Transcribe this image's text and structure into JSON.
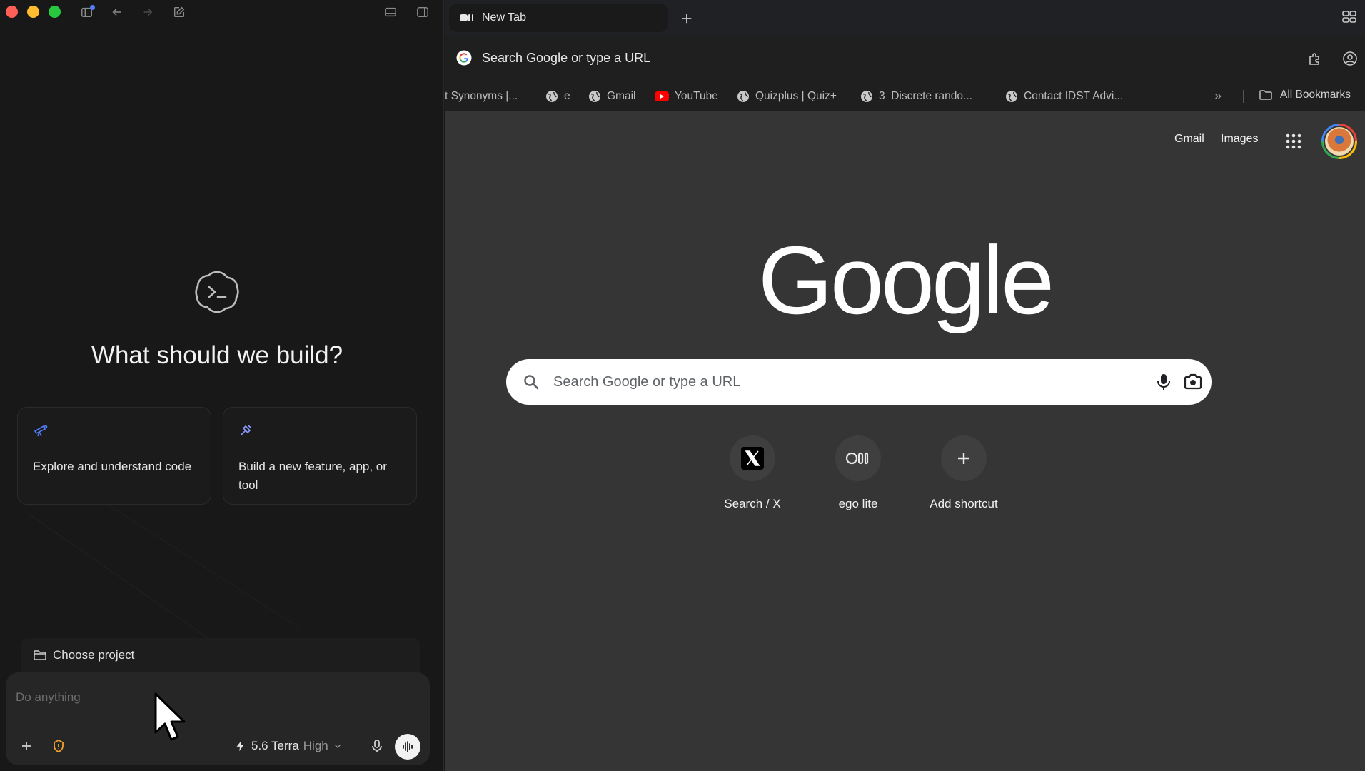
{
  "left_app": {
    "hero_title": "What should we build?",
    "cards": [
      {
        "icon": "telescope-icon",
        "text": "Explore and understand code"
      },
      {
        "icon": "hammer-icon",
        "text": "Build a new feature, app, or tool"
      }
    ],
    "project_selector": {
      "label": "Choose project",
      "icon": "folder-icon"
    },
    "composer": {
      "placeholder": "Do anything",
      "model": "5.6 Terra",
      "effort": "High"
    },
    "colors": {
      "accent_blue": "#4f7cf7",
      "warning_orange": "#f0a030",
      "traffic_red": "#fe5f57",
      "traffic_yellow": "#febc2e",
      "traffic_green": "#28c840"
    }
  },
  "browser": {
    "tab": {
      "label": "New Tab"
    },
    "omnibox": {
      "placeholder": "Search Google or type a URL"
    },
    "bookmarks": [
      {
        "label": "t Synonyms |..."
      },
      {
        "label": "e"
      },
      {
        "label": "Gmail"
      },
      {
        "label": "YouTube"
      },
      {
        "label": "Quizplus | Quiz+"
      },
      {
        "label": "3_Discrete rando..."
      },
      {
        "label": "Contact IDST Advi..."
      }
    ],
    "all_bookmarks": "All Bookmarks",
    "top_links": {
      "gmail": "Gmail",
      "images": "Images"
    },
    "logo_text": "Google",
    "search": {
      "placeholder": "Search Google or type a URL"
    },
    "shortcuts": [
      {
        "label": "Search / X",
        "icon": "x-logo-icon"
      },
      {
        "label": "ego lite",
        "icon": "ego-logo-icon"
      },
      {
        "label": "Add shortcut",
        "icon": "plus-icon"
      }
    ]
  }
}
